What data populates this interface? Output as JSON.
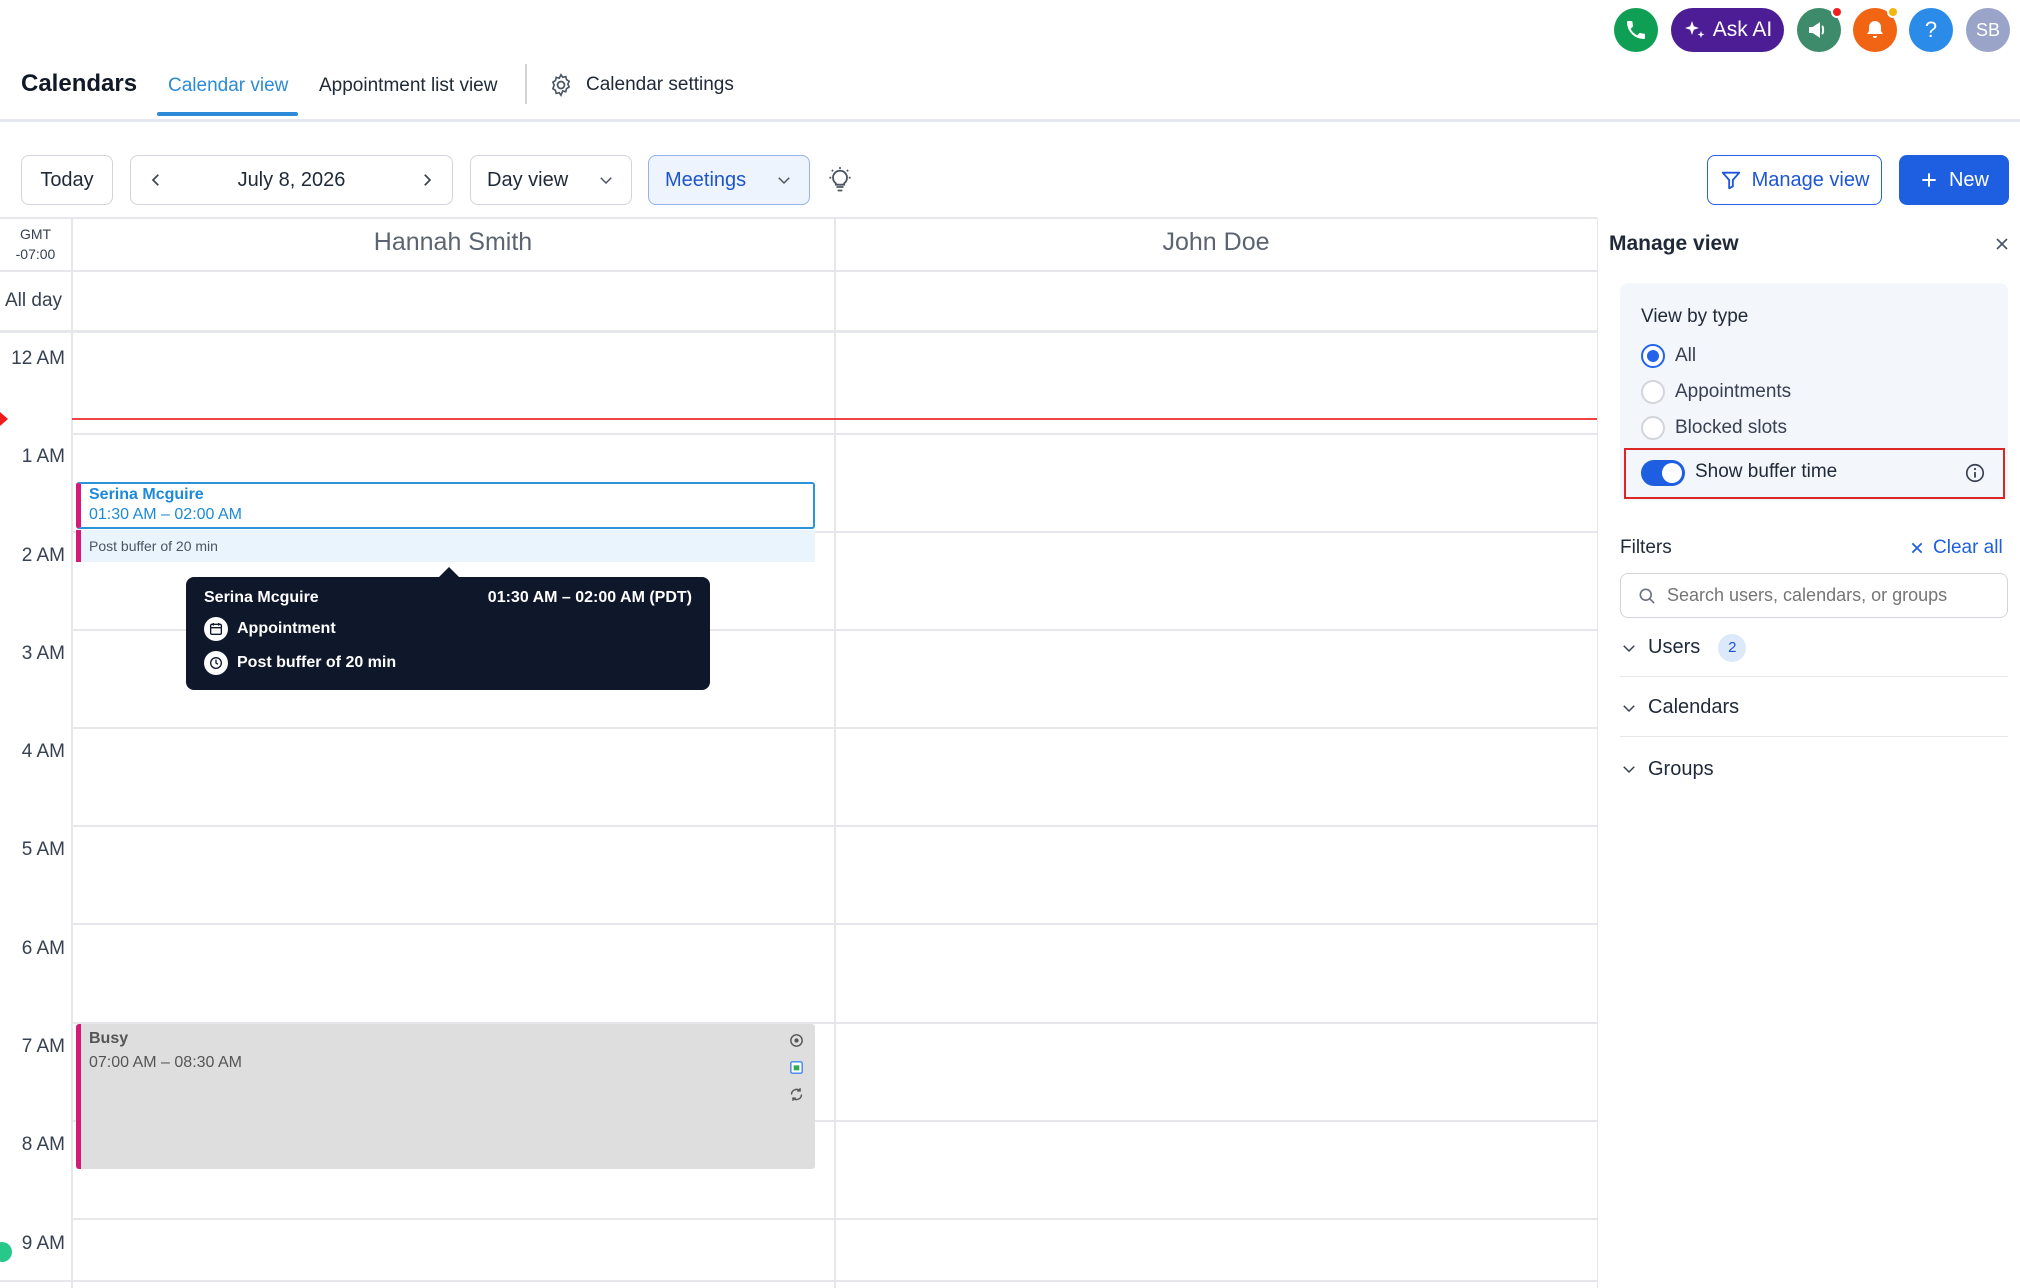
{
  "topbar": {
    "ask_ai_label": "Ask AI",
    "help_label": "?",
    "avatar_initials": "SB"
  },
  "nav": {
    "title": "Calendars",
    "tabs": [
      {
        "label": "Calendar view",
        "active": true
      },
      {
        "label": "Appointment list view",
        "active": false
      }
    ],
    "settings_label": "Calendar settings"
  },
  "toolbar": {
    "today_label": "Today",
    "date_label": "July 8, 2026",
    "view_select": "Day view",
    "type_select": "Meetings",
    "manage_view_label": "Manage view",
    "new_label": "New"
  },
  "grid": {
    "timezone_line1": "GMT",
    "timezone_line2": "-07:00",
    "all_day_label": "All day",
    "columns": [
      "Hannah Smith",
      "John Doe"
    ],
    "hours": [
      "12 AM",
      "1 AM",
      "2 AM",
      "3 AM",
      "4 AM",
      "5 AM",
      "6 AM",
      "7 AM",
      "8 AM",
      "9 AM"
    ]
  },
  "events": {
    "appointment": {
      "title": "Serina Mcguire",
      "time": "01:30 AM – 02:00 AM",
      "buffer": "Post buffer of 20 min"
    },
    "busy": {
      "title": "Busy",
      "time": "07:00 AM – 08:30 AM"
    }
  },
  "tooltip": {
    "name": "Serina Mcguire",
    "time": "01:30 AM – 02:00 AM (PDT)",
    "type": "Appointment",
    "buffer": "Post buffer of 20 min"
  },
  "panel": {
    "title": "Manage view",
    "view_by_type_label": "View by type",
    "options": [
      {
        "label": "All",
        "selected": true
      },
      {
        "label": "Appointments",
        "selected": false
      },
      {
        "label": "Blocked slots",
        "selected": false
      }
    ],
    "buffer_toggle_label": "Show buffer time",
    "buffer_toggle_on": true,
    "filters_label": "Filters",
    "clear_all_label": "Clear all",
    "search_placeholder": "Search users, calendars, or groups",
    "sections": [
      {
        "label": "Users",
        "count": "2"
      },
      {
        "label": "Calendars"
      },
      {
        "label": "Groups"
      }
    ]
  },
  "colors": {
    "primary": "#1d5fe0",
    "tab_active": "#2b8bd6",
    "event_accent": "#d21a78",
    "now_line": "#ef4444",
    "tooltip_bg": "#0f172a"
  }
}
